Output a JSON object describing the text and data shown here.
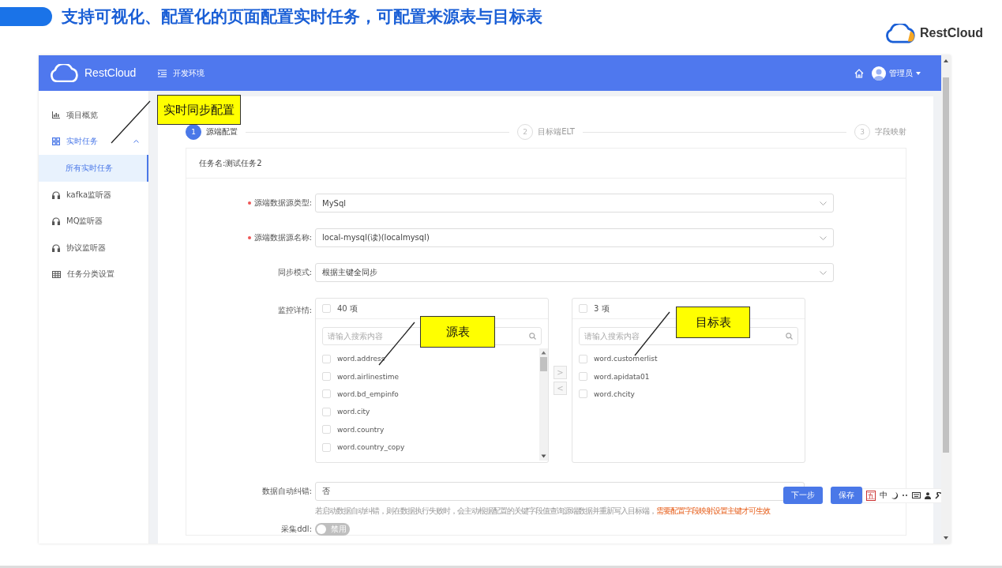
{
  "slide": {
    "title": "支持可视化、配置化的页面配置实时任务，可配置来源表与目标表",
    "logo_text": "RestCloud"
  },
  "topbar": {
    "logo_text": "RestCloud",
    "environment": "开发环境",
    "user": "管理员"
  },
  "sidebar": {
    "items": [
      {
        "label": "项目概览",
        "kind": "chart",
        "selected": false
      },
      {
        "label": "实时任务",
        "kind": "grid",
        "selected": false,
        "expanded": true,
        "children": [
          {
            "label": "所有实时任务",
            "selected": true
          }
        ]
      },
      {
        "label": "kafka监听器",
        "kind": "headset",
        "selected": false
      },
      {
        "label": "MQ监听器",
        "kind": "headset",
        "selected": false
      },
      {
        "label": "协议监听器",
        "kind": "headset",
        "selected": false
      },
      {
        "label": "任务分类设置",
        "kind": "table",
        "selected": false
      }
    ]
  },
  "steps": [
    {
      "number": "1",
      "label": "源端配置",
      "active": true
    },
    {
      "number": "2",
      "label": "目标端ELT",
      "active": false
    },
    {
      "number": "3",
      "label": "字段映射",
      "active": false
    }
  ],
  "task": {
    "name": "任务名:测试任务2"
  },
  "form": [
    {
      "label": "源端数据源类型:",
      "required": true,
      "value": "MySql"
    },
    {
      "label": "源端数据源名称:",
      "required": true,
      "value": "local-mysql(读)(localmysql)"
    },
    {
      "label": "同步模式:",
      "required": false,
      "value": "根据主键全同步"
    }
  ],
  "transfer": {
    "label": "监控详情:",
    "source": {
      "count": "40 项",
      "checked": false,
      "search_placeholder": "请输入搜索内容",
      "items": [
        {
          "name": "word.address",
          "checked": false
        },
        {
          "name": "word.airlinestime",
          "checked": false
        },
        {
          "name": "word.bd_empinfo",
          "checked": false
        },
        {
          "name": "word.city",
          "checked": false
        },
        {
          "name": "word.country",
          "checked": false
        },
        {
          "name": "word.country_copy",
          "checked": false
        }
      ]
    },
    "target": {
      "count": "3 项",
      "checked": false,
      "search_placeholder": "请输入搜索内容",
      "items": [
        {
          "name": "word.customerlist",
          "checked": false
        },
        {
          "name": "word.apidata01",
          "checked": false
        },
        {
          "name": "word.chcity",
          "checked": false
        }
      ]
    },
    "buttons": [
      ">",
      "<"
    ]
  },
  "auto_correct": {
    "label": "数据自动纠错:",
    "value": "否",
    "hint": "若启动数据自动纠错，则在数据执行失败时，会主动根据配置的关键字段值查询源端数据并重新写入目标端，",
    "hint_warning": "需要配置字段映射设置主键才可生效"
  },
  "ddl": {
    "label": "采集ddl:",
    "on": false,
    "state_text": "禁用"
  },
  "actions": [
    "下一步",
    "保存"
  ],
  "ime_toolbar": {
    "items": [
      "五",
      "中"
    ]
  },
  "callouts": [
    {
      "text": "实时同步配置"
    },
    {
      "text": "源表"
    },
    {
      "text": "目标表"
    }
  ]
}
